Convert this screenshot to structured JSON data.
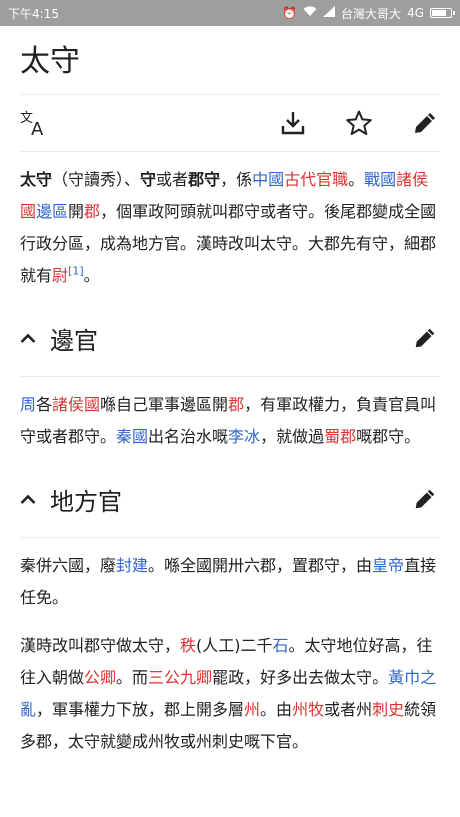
{
  "status_bar": {
    "time": "下午4:15",
    "carrier": "台灣大哥大",
    "network": "4G",
    "icons": [
      "alarm-icon",
      "wifi-icon",
      "signal-icon",
      "battery-icon"
    ],
    "battery_level": 0.85
  },
  "article": {
    "title": "太守"
  },
  "toolbar": {
    "icons": [
      "translate-icon",
      "download-icon",
      "star-icon",
      "edit-icon"
    ]
  },
  "lead": {
    "t1": "太守",
    "t2": "（守讀秀）、",
    "t3": "守",
    "t4": "或者",
    "t5": "郡守",
    "t6": "，係",
    "t7": "中國",
    "t8": "古代官職",
    "t9": "。",
    "t10": "戰國",
    "t11": "諸侯國",
    "t12": "邊區",
    "t13": "開",
    "t14": "郡",
    "t15": "，個軍政阿頭就叫郡守或者守。後尾郡變成全國行政分區，成為地方官。漢時改叫太守。大郡先有守，細郡就有",
    "t16": "尉",
    "t17": "[1]",
    "t18": "。"
  },
  "sections": [
    {
      "heading": "邊官",
      "p1": {
        "t1": "周",
        "t2": "各",
        "t3": "諸侯國",
        "t4": "喺自己軍事邊區開",
        "t5": "郡",
        "t6": "，有軍政權力，負責官員叫守或者郡守。",
        "t7": "秦國",
        "t8": "出名治水嘅",
        "t9": "李冰",
        "t10": "，就做過",
        "t11": "蜀郡",
        "t12": "嘅郡守。"
      }
    },
    {
      "heading": "地方官",
      "p1": {
        "t1": "秦併六國，廢",
        "t2": "封建",
        "t3": "。喺全國開卅六郡，置郡守，由",
        "t4": "皇帝",
        "t5": "直接任免。"
      },
      "p2": {
        "t1": "漢時改叫郡守做太守，",
        "t2": "秩",
        "t3": "(人工)二千",
        "t4": "石",
        "t5": "。太守地位好高，往往入朝做",
        "t6": "公卿",
        "t7": "。而",
        "t8": "三公九卿",
        "t9": "罷政，好多出去做太守。",
        "t10": "黃巾之亂",
        "t11": "，軍事權力下放，郡上開多層",
        "t12": "州",
        "t13": "。由",
        "t14": "州牧",
        "t15": "或者州",
        "t16": "刺史",
        "t17": "統領多郡，太守就變成州牧或州刺史嘅下官。"
      }
    }
  ],
  "colors": {
    "link_blue": "#3366cc",
    "link_red": "#d33",
    "status_bar_bg": "#9e9e9e",
    "text": "#202122"
  }
}
